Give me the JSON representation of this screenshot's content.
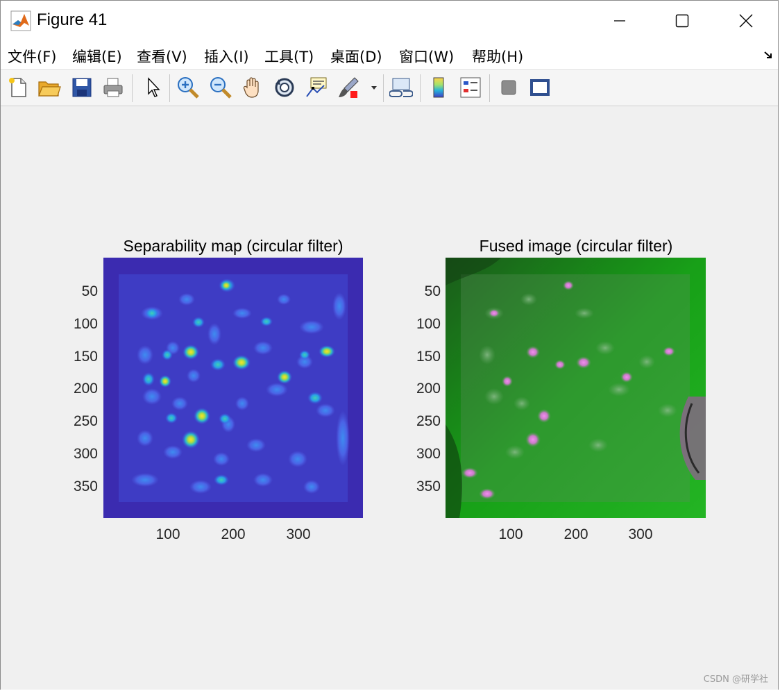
{
  "window": {
    "title": "Figure 41",
    "icon": "matlab-logo-icon",
    "controls": [
      "minimize-icon",
      "maximize-icon",
      "close-icon"
    ]
  },
  "menu": [
    {
      "label": "文件(F)",
      "name": "menu-file"
    },
    {
      "label": "编辑(E)",
      "name": "menu-edit"
    },
    {
      "label": "查看(V)",
      "name": "menu-view"
    },
    {
      "label": "插入(I)",
      "name": "menu-insert"
    },
    {
      "label": "工具(T)",
      "name": "menu-tools"
    },
    {
      "label": "桌面(D)",
      "name": "menu-desktop"
    },
    {
      "label": "窗口(W)",
      "name": "menu-window"
    },
    {
      "label": "帮助(H)",
      "name": "menu-help"
    }
  ],
  "toolbar": {
    "buttons": [
      "new-figure-icon",
      "open-file-icon",
      "save-icon",
      "print-icon",
      "select-arrow-icon",
      "zoom-in-icon",
      "zoom-out-icon",
      "pan-hand-icon",
      "rotate-3d-icon",
      "data-cursor-icon",
      "brush-icon",
      "link-plot-icon",
      "colorbar-icon",
      "legend-icon",
      "hide-plot-tools-icon",
      "show-plot-tools-icon"
    ]
  },
  "axes": [
    {
      "title": "Separability map (circular filter)",
      "yticks": [
        "50",
        "100",
        "150",
        "200",
        "250",
        "300",
        "350"
      ],
      "xticks": [
        "100",
        "200",
        "300"
      ],
      "image": "separability-heatmap",
      "background_color": "#3b2bb0"
    },
    {
      "title": "Fused image (circular filter)",
      "yticks": [
        "50",
        "100",
        "150",
        "200",
        "250",
        "300",
        "350"
      ],
      "xticks": [
        "100",
        "200",
        "300"
      ],
      "image": "fused-green-magenta-image",
      "background_color": "#1fbf1f"
    }
  ],
  "watermark": "CSDN @研学社"
}
